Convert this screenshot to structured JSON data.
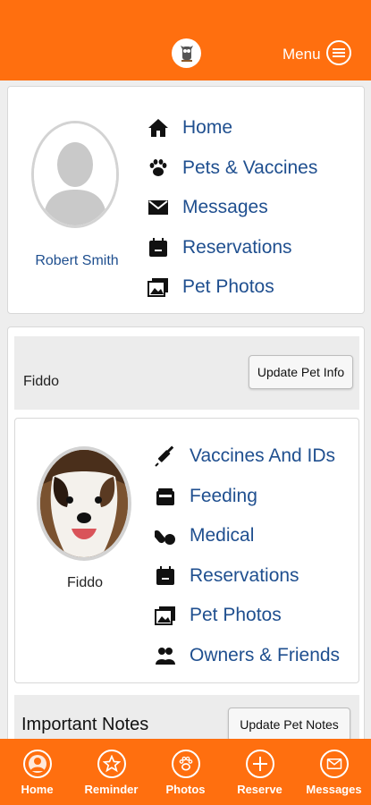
{
  "header": {
    "menu_label": "Menu",
    "logo_icon": "owl-icon",
    "accent_color": "#ff6f0f"
  },
  "user": {
    "name": "Robert Smith"
  },
  "main_nav": [
    {
      "label": "Home",
      "icon": "home-icon"
    },
    {
      "label": "Pets & Vaccines",
      "icon": "paw-icon"
    },
    {
      "label": "Messages",
      "icon": "envelope-icon"
    },
    {
      "label": "Reservations",
      "icon": "calendar-icon"
    },
    {
      "label": "Pet Photos",
      "icon": "photos-icon"
    }
  ],
  "pet": {
    "name_header": "Fiddo",
    "update_info_label": "Update Pet Info",
    "name": "Fiddo",
    "nav": [
      {
        "label": "Vaccines And IDs",
        "icon": "syringe-icon"
      },
      {
        "label": "Feeding",
        "icon": "food-bowl-icon"
      },
      {
        "label": "Medical",
        "icon": "pills-icon"
      },
      {
        "label": "Reservations",
        "icon": "calendar-icon"
      },
      {
        "label": "Pet Photos",
        "icon": "photos-icon"
      },
      {
        "label": "Owners & Friends",
        "icon": "users-icon"
      }
    ]
  },
  "notes": {
    "title": "Important Notes",
    "update_label": "Update Pet Notes"
  },
  "tabs": [
    {
      "label": "Home",
      "icon": "person-icon"
    },
    {
      "label": "Reminder",
      "icon": "star-icon"
    },
    {
      "label": "Photos",
      "icon": "paw-icon"
    },
    {
      "label": "Reserve",
      "icon": "plus-icon"
    },
    {
      "label": "Messages",
      "icon": "envelope-icon"
    }
  ]
}
